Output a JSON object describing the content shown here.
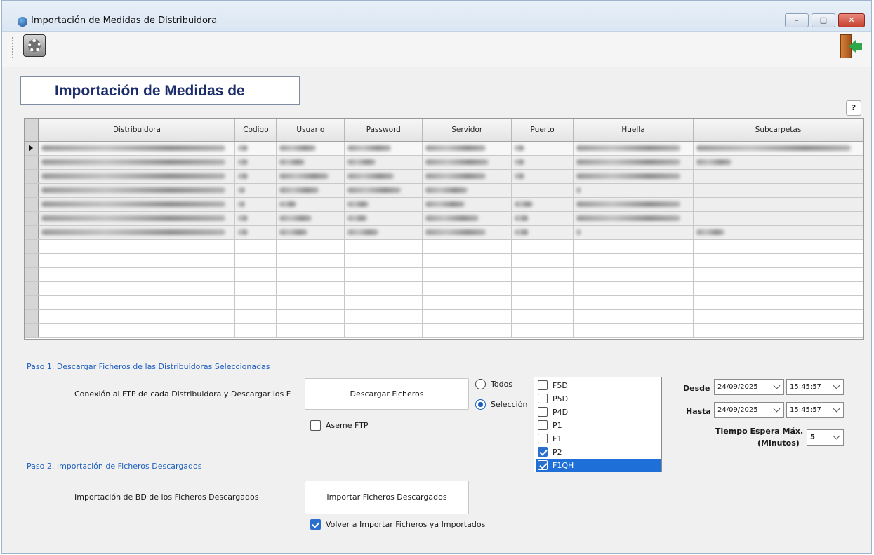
{
  "window": {
    "title": "Importación de Medidas de Distribuidora",
    "btn_min": "–",
    "btn_max": "□",
    "btn_close": "✕"
  },
  "header": {
    "title": "Importación de Medidas de",
    "help": "?"
  },
  "grid": {
    "columns": [
      "Distribuidora",
      "Codigo",
      "Usuario",
      "Password",
      "Servidor",
      "Puerto",
      "Huella",
      "Subcarpetas"
    ],
    "data_rows": 7,
    "empty_rows": 7
  },
  "step1": {
    "title": "Paso 1. Descargar Ficheros de las Distribuidoras Seleccionadas",
    "conexion_label": "Conexión al FTP de cada Distribuidora y Descargar los F",
    "download_button": "Descargar Ficheros",
    "asemeftp_label": "Aseme FTP",
    "asemeftp_checked": false,
    "radio_todos": "Todos",
    "radio_seleccion": "Selección",
    "radio_selected": "Selección",
    "file_types": [
      {
        "label": "F5D",
        "checked": false,
        "selected": false
      },
      {
        "label": "P5D",
        "checked": false,
        "selected": false
      },
      {
        "label": "P4D",
        "checked": false,
        "selected": false
      },
      {
        "label": "P1",
        "checked": false,
        "selected": false
      },
      {
        "label": "F1",
        "checked": false,
        "selected": false
      },
      {
        "label": "P2",
        "checked": true,
        "selected": false
      },
      {
        "label": "F1QH",
        "checked": true,
        "selected": true
      }
    ]
  },
  "dates": {
    "desde_label": "Desde",
    "desde_date": "24/09/2025",
    "desde_time": "15:45:57",
    "hasta_label": "Hasta",
    "hasta_date": "24/09/2025",
    "hasta_time": "15:45:57",
    "espera_label_1": "Tiempo Espera Máx.",
    "espera_label_2": "(Minutos)",
    "espera_value": "5"
  },
  "step2": {
    "title": "Paso 2. Importación de Ficheros Descargados",
    "import_label": "Importación de BD de los Ficheros Descargados",
    "import_button": "Importar Ficheros Descargados",
    "reimport_label": "Volver a Importar Ficheros ya Importados",
    "reimport_checked": true
  },
  "colors": {
    "accent": "#1f5fbf",
    "header_title": "#1c2d6b",
    "selection": "#1f6fd8"
  }
}
